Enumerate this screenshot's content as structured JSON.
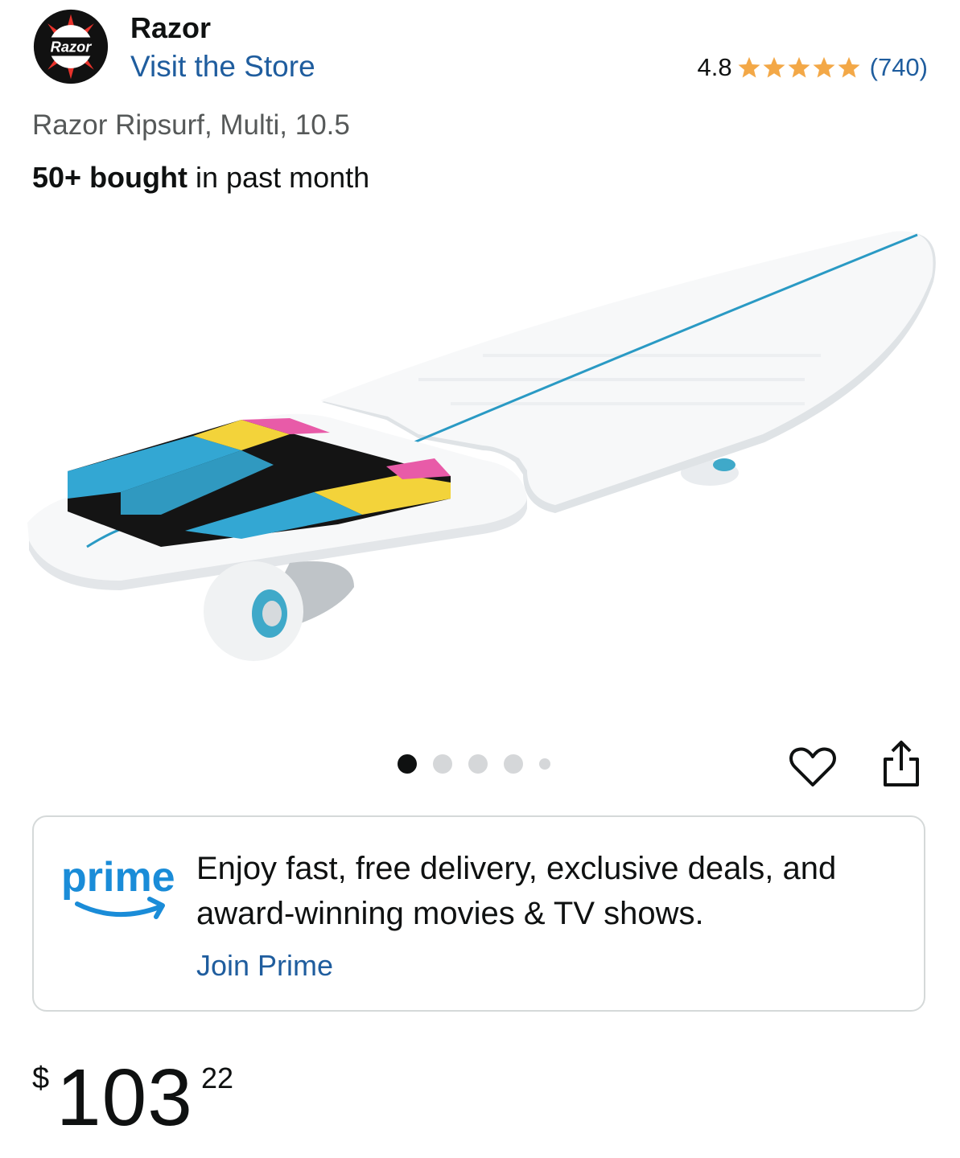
{
  "brand": {
    "logo_text": "Razor",
    "name": "Razor",
    "visit_store": "Visit the Store"
  },
  "rating": {
    "value": "4.8",
    "stars": 4.8,
    "count": "(740)",
    "star_color": "#f3a847"
  },
  "product": {
    "title": "Razor Ripsurf, Multi, 10.5",
    "bought_bold": "50+ bought",
    "bought_rest": " in past month"
  },
  "carousel": {
    "total_dots": 5,
    "active_index": 0
  },
  "icons": {
    "heart": "heart-icon",
    "share": "share-icon"
  },
  "prime": {
    "logo_word": "prime",
    "description": "Enjoy fast, free delivery, exclusive deals, and award-winning movies & TV shows.",
    "join_label": "Join Prime",
    "brand_color": "#1a8cd8"
  },
  "price": {
    "symbol": "$",
    "whole": "103",
    "fraction": "22"
  },
  "colors": {
    "link": "#1f5d9e",
    "text": "#0f1111",
    "muted": "#565959"
  }
}
